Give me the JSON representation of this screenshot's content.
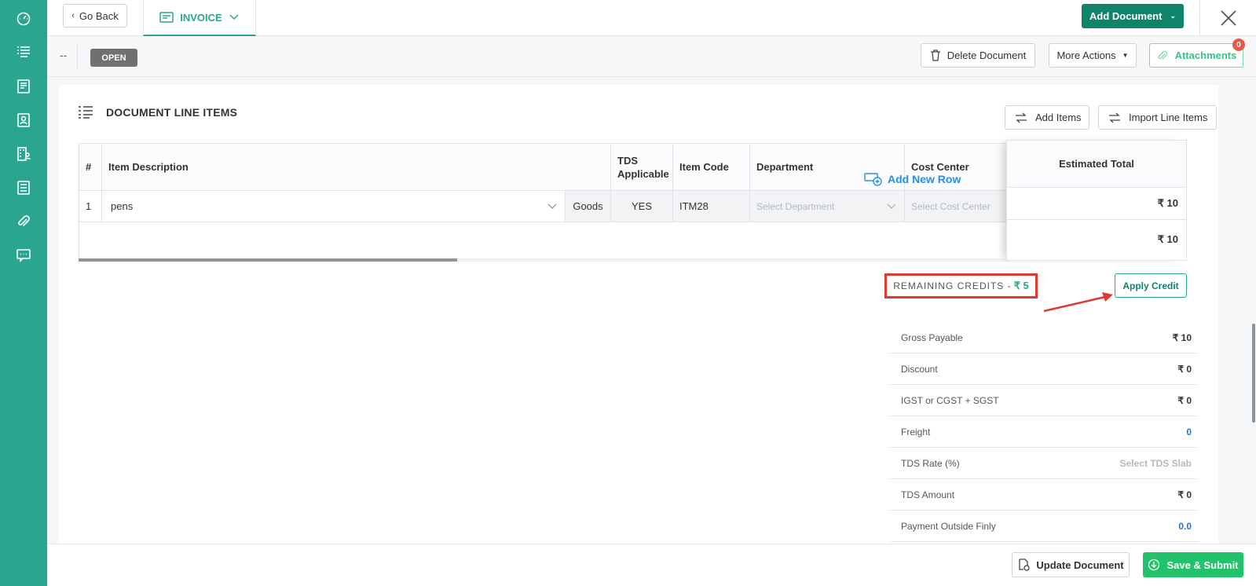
{
  "topbar": {
    "back_label": "Go Back",
    "doc_type": "INVOICE",
    "add_document_label": "Add Document"
  },
  "status": {
    "dash": "--",
    "badge": "OPEN",
    "delete_label": "Delete Document",
    "more_actions_label": "More Actions",
    "attachments_label": "Attachments",
    "attachments_count": "0"
  },
  "section": {
    "title": "DOCUMENT LINE ITEMS",
    "add_items_label": "Add Items",
    "import_label": "Import Line Items"
  },
  "table": {
    "headers": {
      "num": "#",
      "desc": "Item Description",
      "tds": "TDS Applicable",
      "code": "Item Code",
      "dept": "Department",
      "cost": "Cost Center",
      "est": "Estimated Total"
    },
    "row": {
      "num": "1",
      "desc": "pens",
      "type": "Goods",
      "tds": "YES",
      "code": "ITM28",
      "dept_placeholder": "Select Department",
      "cost_placeholder": "Select Cost Center",
      "est": "₹  10"
    },
    "total": "₹ 10",
    "add_row_label": "Add New Row"
  },
  "credits": {
    "label": "REMAINING CREDITS -",
    "value": "₹ 5",
    "apply_label": "Apply Credit"
  },
  "summary": [
    {
      "label": "Gross Payable",
      "value": "₹ 10",
      "style": ""
    },
    {
      "label": "Discount",
      "value": "₹ 0",
      "style": ""
    },
    {
      "label": "IGST or CGST + SGST",
      "value": "₹ 0",
      "style": ""
    },
    {
      "label": "Freight",
      "value": "0",
      "style": "blue"
    },
    {
      "label": "TDS Rate (%)",
      "value": "Select TDS Slab",
      "style": "muted"
    },
    {
      "label": "TDS Amount",
      "value": "₹ 0",
      "style": ""
    },
    {
      "label": "Payment Outside Finly",
      "value": "0.0",
      "style": "blue"
    }
  ],
  "footer": {
    "update_label": "Update Document",
    "save_label": "Save & Submit"
  },
  "colors": {
    "sidebar": "#2aa58f",
    "primary": "#11836b",
    "save": "#21c26b",
    "highlight": "#e03a2f"
  }
}
